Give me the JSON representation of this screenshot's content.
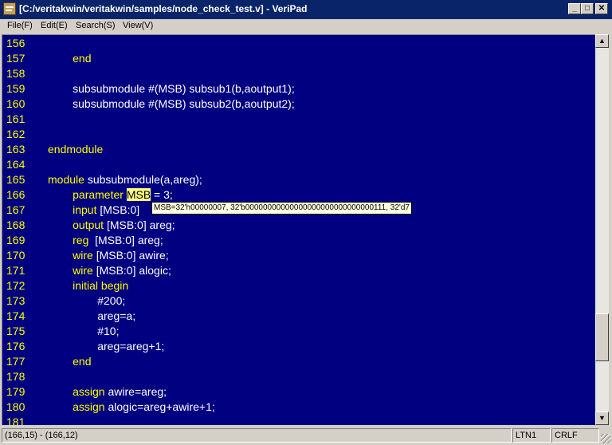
{
  "window": {
    "title": "[C:/veritakwin/veritakwin/samples/node_check_test.v] - VeriPad",
    "minimize": "_",
    "maximize": "□",
    "close": "✕"
  },
  "menu": {
    "file": "File(F)",
    "edit": "Edit(E)",
    "search": "Search(S)",
    "view": "View(V)"
  },
  "editor": {
    "line_numbers": [
      "156",
      "157",
      "158",
      "159",
      "160",
      "161",
      "162",
      "163",
      "164",
      "165",
      "166",
      "167",
      "168",
      "169",
      "170",
      "171",
      "172",
      "173",
      "174",
      "175",
      "176",
      "177",
      "178",
      "179",
      "180",
      "181"
    ],
    "lines": [
      [],
      [
        {
          "t": "        end",
          "c": "y"
        }
      ],
      [],
      [
        {
          "t": "        subsubmodule #(MSB) subsub1(b,aoutput1);",
          "c": "w"
        }
      ],
      [
        {
          "t": "        subsubmodule #(MSB) subsub2(b,aoutput2);",
          "c": "w"
        }
      ],
      [],
      [],
      [
        {
          "t": "endmodule",
          "c": "y"
        }
      ],
      [],
      [
        {
          "t": "module ",
          "c": "y"
        },
        {
          "t": "subsubmodule(a,areg);",
          "c": "w"
        }
      ],
      [
        {
          "t": "        parameter ",
          "c": "y"
        },
        {
          "t": "MSB",
          "c": "hl"
        },
        {
          "t": " = 3;",
          "c": "w"
        }
      ],
      [
        {
          "t": "        input ",
          "c": "y"
        },
        {
          "t": "[MSB:0] ",
          "c": "w"
        }
      ],
      [
        {
          "t": "        output ",
          "c": "y"
        },
        {
          "t": "[MSB:0] areg;",
          "c": "w"
        }
      ],
      [
        {
          "t": "        reg  ",
          "c": "y"
        },
        {
          "t": "[MSB:0] areg;",
          "c": "w"
        }
      ],
      [
        {
          "t": "        wire ",
          "c": "y"
        },
        {
          "t": "[MSB:0] awire;",
          "c": "w"
        }
      ],
      [
        {
          "t": "        wire ",
          "c": "y"
        },
        {
          "t": "[MSB:0] alogic;",
          "c": "w"
        }
      ],
      [
        {
          "t": "        initial begin",
          "c": "y"
        }
      ],
      [
        {
          "t": "                #200;",
          "c": "w"
        }
      ],
      [
        {
          "t": "                areg=a;",
          "c": "w"
        }
      ],
      [
        {
          "t": "                #10;",
          "c": "w"
        }
      ],
      [
        {
          "t": "                areg=areg+1;",
          "c": "w"
        }
      ],
      [
        {
          "t": "        end",
          "c": "y"
        }
      ],
      [],
      [
        {
          "t": "        assign ",
          "c": "y"
        },
        {
          "t": "awire=areg;",
          "c": "w"
        }
      ],
      [
        {
          "t": "        assign ",
          "c": "y"
        },
        {
          "t": "alogic=areg+awire+1;",
          "c": "w"
        }
      ],
      []
    ],
    "tooltip": "MSB=32'h00000007, 32'b00000000000000000000000000000111, 32'd7"
  },
  "scrollbar": {
    "up": "▲",
    "down": "▼"
  },
  "status": {
    "position": "(166,15) - (166,12)",
    "mode": "LTN1",
    "eol": "CRLF"
  },
  "colors": {
    "background": "#000080",
    "keyword": "#ffff00",
    "text": "#ffffff",
    "highlight": "#ffff80",
    "titlebar": "#0a246a"
  }
}
